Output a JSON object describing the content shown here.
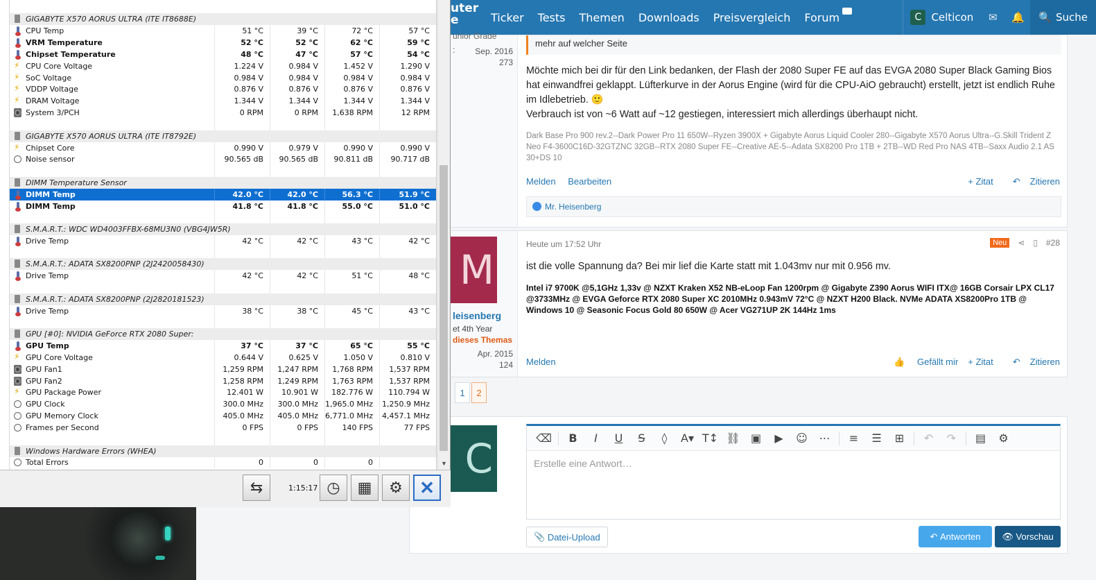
{
  "hwinfo": {
    "rows": [
      {
        "type": "grp",
        "label": "GIGABYTE X570 AORUS ULTRA (ITE IT8688E)"
      },
      {
        "type": "row",
        "icon": "therm",
        "label": "CPU Temp",
        "v": [
          "51 °C",
          "39 °C",
          "72 °C",
          "57 °C"
        ]
      },
      {
        "type": "row",
        "icon": "therm",
        "bold": true,
        "label": "VRM Temperature",
        "v": [
          "52 °C",
          "52 °C",
          "62 °C",
          "59 °C"
        ]
      },
      {
        "type": "row",
        "icon": "therm",
        "bold": true,
        "label": "Chipset Temperature",
        "v": [
          "48 °C",
          "47 °C",
          "57 °C",
          "54 °C"
        ]
      },
      {
        "type": "row",
        "icon": "volt",
        "label": "CPU Core Voltage",
        "v": [
          "1.224 V",
          "0.984 V",
          "1.452 V",
          "1.290 V"
        ]
      },
      {
        "type": "row",
        "icon": "volt",
        "label": "SoC Voltage",
        "v": [
          "0.984 V",
          "0.984 V",
          "0.984 V",
          "0.984 V"
        ]
      },
      {
        "type": "row",
        "icon": "volt",
        "label": "VDDP Voltage",
        "v": [
          "0.876 V",
          "0.876 V",
          "0.876 V",
          "0.876 V"
        ]
      },
      {
        "type": "row",
        "icon": "volt",
        "label": "DRAM Voltage",
        "v": [
          "1.344 V",
          "1.344 V",
          "1.344 V",
          "1.344 V"
        ]
      },
      {
        "type": "row",
        "icon": "fan",
        "label": "System 3/PCH",
        "v": [
          "0 RPM",
          "0 RPM",
          "1,638 RPM",
          "12 RPM"
        ]
      },
      {
        "type": "blank"
      },
      {
        "type": "grp",
        "label": "GIGABYTE X570 AORUS ULTRA (ITE IT8792E)"
      },
      {
        "type": "row",
        "icon": "volt",
        "label": "Chipset Core",
        "v": [
          "0.990 V",
          "0.979 V",
          "0.990 V",
          "0.990 V"
        ]
      },
      {
        "type": "row",
        "icon": "gauge",
        "label": "Noise sensor",
        "v": [
          "90.565 dB",
          "90.565 dB",
          "90.811 dB",
          "90.717 dB"
        ]
      },
      {
        "type": "blank"
      },
      {
        "type": "grp",
        "label": "DIMM Temperature Sensor"
      },
      {
        "type": "row",
        "icon": "therm",
        "bold": true,
        "sel": true,
        "label": "DIMM Temp",
        "v": [
          "42.0 °C",
          "42.0 °C",
          "56.3 °C",
          "51.9 °C"
        ]
      },
      {
        "type": "row",
        "icon": "therm",
        "bold": true,
        "label": "DIMM Temp",
        "v": [
          "41.8 °C",
          "41.8 °C",
          "55.0 °C",
          "51.0 °C"
        ]
      },
      {
        "type": "blank"
      },
      {
        "type": "grp",
        "label": "S.M.A.R.T.: WDC WD4003FFBX-68MU3N0 (VBG4JW5R)"
      },
      {
        "type": "row",
        "icon": "therm",
        "label": "Drive Temp",
        "v": [
          "42 °C",
          "42 °C",
          "43 °C",
          "42 °C"
        ]
      },
      {
        "type": "blank"
      },
      {
        "type": "grp",
        "label": "S.M.A.R.T.: ADATA SX8200PNP (2J2420058430)"
      },
      {
        "type": "row",
        "icon": "therm",
        "label": "Drive Temp",
        "v": [
          "42 °C",
          "42 °C",
          "51 °C",
          "48 °C"
        ]
      },
      {
        "type": "blank"
      },
      {
        "type": "grp",
        "label": "S.M.A.R.T.: ADATA SX8200PNP (2J2820181523)"
      },
      {
        "type": "row",
        "icon": "therm",
        "label": "Drive Temp",
        "v": [
          "38 °C",
          "38 °C",
          "45 °C",
          "43 °C"
        ]
      },
      {
        "type": "blank"
      },
      {
        "type": "grp",
        "label": "GPU [#0]: NVIDIA GeForce RTX 2080 Super:"
      },
      {
        "type": "row",
        "icon": "therm",
        "bold": true,
        "label": "GPU Temp",
        "v": [
          "37 °C",
          "37 °C",
          "65 °C",
          "55 °C"
        ]
      },
      {
        "type": "row",
        "icon": "volt",
        "label": "GPU Core Voltage",
        "v": [
          "0.644 V",
          "0.625 V",
          "1.050 V",
          "0.810 V"
        ]
      },
      {
        "type": "row",
        "icon": "fan",
        "label": "GPU Fan1",
        "v": [
          "1,259 RPM",
          "1,247 RPM",
          "1,768 RPM",
          "1,537 RPM"
        ]
      },
      {
        "type": "row",
        "icon": "fan",
        "label": "GPU Fan2",
        "v": [
          "1,258 RPM",
          "1,249 RPM",
          "1,763 RPM",
          "1,537 RPM"
        ]
      },
      {
        "type": "row",
        "icon": "volt",
        "label": "GPU Package Power",
        "v": [
          "12.401 W",
          "10.901 W",
          "182.776 W",
          "110.794 W"
        ]
      },
      {
        "type": "row",
        "icon": "gauge",
        "label": "GPU Clock",
        "v": [
          "300.0 MHz",
          "300.0 MHz",
          "1,965.0 MHz",
          "1,250.9 MHz"
        ]
      },
      {
        "type": "row",
        "icon": "gauge",
        "label": "GPU Memory Clock",
        "v": [
          "405.0 MHz",
          "405.0 MHz",
          "6,771.0 MHz",
          "4,457.1 MHz"
        ]
      },
      {
        "type": "row",
        "icon": "gauge",
        "label": "Frames per Second",
        "v": [
          "0 FPS",
          "0 FPS",
          "140 FPS",
          "77 FPS"
        ]
      },
      {
        "type": "blank"
      },
      {
        "type": "grp",
        "label": "Windows Hardware Errors (WHEA)"
      },
      {
        "type": "row",
        "icon": "gauge",
        "label": "Total Errors",
        "v": [
          "0",
          "0",
          "0",
          ""
        ]
      }
    ],
    "elapsed": "1:15:17"
  },
  "nav": {
    "brand": "uter\ne",
    "links": [
      "Ticker",
      "Tests",
      "Themen",
      "Downloads",
      "Preisvergleich",
      "Forum"
    ],
    "user_initial": "C",
    "username": "Celticon",
    "search": "Suche"
  },
  "post1": {
    "user_title_frag": "unior Grade",
    "joined": "Sep. 2016",
    "count": "273",
    "quote": "mehr auf welcher Seite",
    "text": "Möchte mich bei dir für den Link bedanken, der Flash der 2080 Super FE auf das EVGA 2080 Super Black Gaming Bios hat einwandfrei geklappt. Lüfterkurve in der Aorus Engine (wird für die CPU-AiO gebraucht) erstellt, jetzt ist endlich Ruhe im Idlebetrieb. 🙂",
    "text2": "Verbrauch ist von ~6 Watt auf ~12 gestiegen, interessiert mich allerdings überhaupt nicht.",
    "signature": "Dark Base Pro 900 rev.2--Dark Power Pro 11 650W--Ryzen 3900X + Gigabyte Aorus Liquid Cooler 280--Gigabyte X570 Aorus Ultra--G.Skill Trident Z Neo F4-3600C16D-32GTZNC 32GB--RTX 2080 Super FE--Creative AE-5--Adata SX8200 Pro 1TB + 2TB--WD Red Pro NAS 4TB--Saxx Audio 2.1 AS 30+DS 10",
    "melden": "Melden",
    "bearbeiten": "Bearbeiten",
    "zitat": "+ Zitat",
    "zitieren": "Zitieren",
    "reaction_user": "Mr. Heisenberg"
  },
  "post2": {
    "avatar_letter": "M",
    "username": "leisenberg",
    "user_title": "et 4th Year",
    "starter": "dieses Themas",
    "joined": "Apr. 2015",
    "count": "124",
    "time": "Heute um 17:52 Uhr",
    "badge": "Neu",
    "number": "#28",
    "text": "ist die volle Spannung da? Bei mir lief die Karte statt mit 1.043mv nur mit 0.956 mv.",
    "signature": "Intel i7 9700K @5,1GHz 1,33v @ NZXT Kraken X52 NB-eLoop Fan 1200rpm @ Gigabyte Z390 Aorus WIFI ITX@ 16GB Corsair LPX CL17 @3733MHz @ EVGA Geforce RTX 2080 Super XC 2010MHz 0.943mV 72°C @ NZXT H200 Black. NVMe ADATA XS8200Pro 1TB @ Windows 10 @ Seasonic Focus Gold 80 650W @ Acer VG271UP 2K 144Hz 1ms",
    "melden": "Melden",
    "gefaellt": "Gefällt mir",
    "zitat": "+ Zitat",
    "zitieren": "Zitieren"
  },
  "pager": [
    "1",
    "2"
  ],
  "reply": {
    "avatar_letter": "C",
    "placeholder": "Erstelle eine Antwort…",
    "upload": "Datei-Upload",
    "answer": "Antworten",
    "preview": "Vorschau"
  },
  "colors": {
    "accent": "#2577b1",
    "selection": "#0f6fd1",
    "new_badge": "#f06a1a"
  }
}
